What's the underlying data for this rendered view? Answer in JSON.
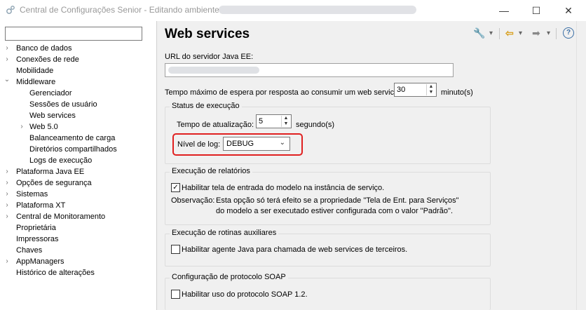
{
  "window": {
    "title": "Central de Configurações Senior - Editando ambiente",
    "controls": {
      "minimize": "—",
      "maximize": "☐",
      "close": "✕"
    }
  },
  "sidebar": {
    "search_value": "",
    "items": [
      {
        "label": "Banco de dados",
        "expander": "›"
      },
      {
        "label": "Conexões de rede",
        "expander": "›"
      },
      {
        "label": "Mobilidade",
        "expander": ""
      },
      {
        "label": "Middleware",
        "expander": "⌄"
      },
      {
        "label": "Gerenciador",
        "expander": ""
      },
      {
        "label": "Sessões de usuário",
        "expander": ""
      },
      {
        "label": "Web services",
        "expander": ""
      },
      {
        "label": "Web 5.0",
        "expander": "›"
      },
      {
        "label": "Balanceamento de carga",
        "expander": ""
      },
      {
        "label": "Diretórios compartilhados",
        "expander": ""
      },
      {
        "label": "Logs de execução",
        "expander": ""
      },
      {
        "label": "Plataforma Java EE",
        "expander": "›"
      },
      {
        "label": "Opções de segurança",
        "expander": "›"
      },
      {
        "label": "Sistemas",
        "expander": "›"
      },
      {
        "label": "Plataforma XT",
        "expander": "›"
      },
      {
        "label": "Central de Monitoramento",
        "expander": "›"
      },
      {
        "label": "Proprietária",
        "expander": ""
      },
      {
        "label": "Impressoras",
        "expander": ""
      },
      {
        "label": "Chaves",
        "expander": ""
      },
      {
        "label": "AppManagers",
        "expander": "›"
      },
      {
        "label": "Histórico de alterações",
        "expander": ""
      }
    ]
  },
  "main": {
    "title": "Web services",
    "toolbar": {
      "tools": "🔧",
      "back": "⇦",
      "forward": "➡",
      "dropdown": "▾",
      "help": "?"
    },
    "server_url_label": "URL do servidor Java EE:",
    "timeout_label": "Tempo máximo de espera por resposta ao consumir um web service:",
    "timeout_value": "30",
    "timeout_unit": "minuto(s)",
    "exec_status": {
      "title": "Status de execução",
      "refresh_label": "Tempo de atualização:",
      "refresh_value": "5",
      "refresh_unit": "segundo(s)",
      "log_level_label": "Nível de log:",
      "log_level_value": "DEBUG"
    },
    "reports": {
      "title": "Execução de relatórios",
      "checkbox_label": "Habilitar tela de entrada do modelo na instância de serviço.",
      "checked": true,
      "note_label": "Observação:",
      "note_line1": "Esta opção só terá efeito se a propriedade \"Tela de Ent. para Serviços\"",
      "note_line2": "do modelo a ser executado estiver configurada com o valor \"Padrão\"."
    },
    "aux": {
      "title": "Execução de rotinas auxiliares",
      "checkbox_label": "Habilitar agente Java para chamada de web services de terceiros.",
      "checked": false
    },
    "soap": {
      "title": "Configuração de protocolo SOAP",
      "checkbox_label": "Habilitar uso do protocolo SOAP 1.2.",
      "checked": false
    }
  }
}
